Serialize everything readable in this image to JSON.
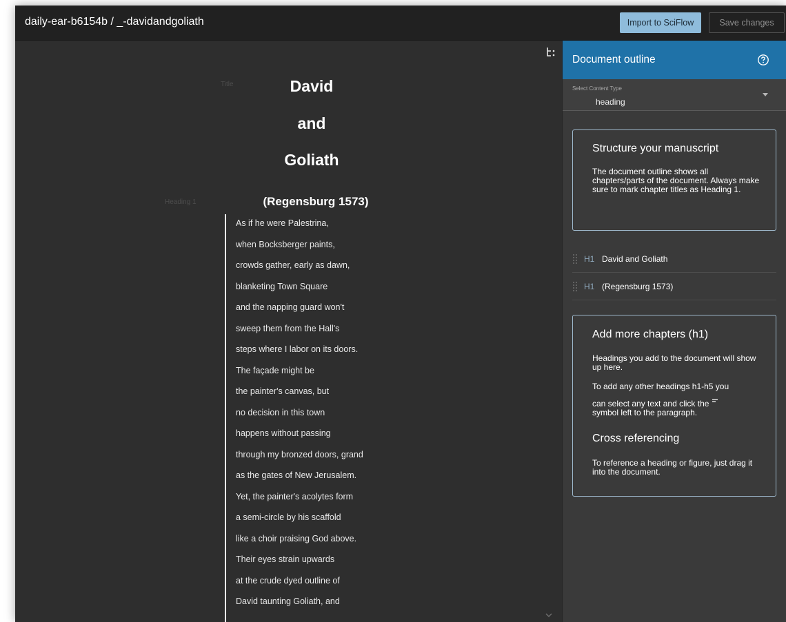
{
  "header": {
    "doc_path": "daily-ear-b6154b / _-davidandgoliath",
    "import_label": "Import to SciFlow",
    "save_label": "Save changes"
  },
  "editor": {
    "title_type_label": "Title",
    "title_lines": [
      "David",
      "and",
      "Goliath"
    ],
    "heading_type_label": "Heading 1",
    "heading_text": "(Regensburg 1573)",
    "verse_lines": [
      "As if he were Palestrina,",
      "when Bocksberger paints,",
      "crowds gather, early as dawn,",
      "blanketing Town Square",
      "and the napping guard won't",
      "sweep them from the Hall's",
      "steps where I labor on its doors.",
      "The façade might be",
      "the painter's canvas, but",
      "no decision in this town",
      "happens without passing",
      "through my bronzed doors, grand",
      "as the gates of New Jerusalem.",
      "Yet, the painter's acolytes form",
      "a semi-circle by his scaffold",
      "like a choir praising God above.",
      "Their eyes strain upwards",
      "at the crude dyed outline of",
      "David taunting Goliath, and"
    ]
  },
  "sidebar": {
    "title": "Document outline",
    "select_label": "Select Content Type",
    "select_value": "heading",
    "card1_title": "Structure your manuscript",
    "card1_text": "The document outline shows all chapters/parts of the document. Always make sure to mark chapter titles as Heading 1.",
    "outline_items": [
      {
        "tag": "H1",
        "text": "David and Goliath"
      },
      {
        "tag": "H1",
        "text": "(Regensburg 1573)"
      }
    ],
    "card2_title": "Add more chapters (h1)",
    "card2_text1": "Headings you add to the document will show up here.",
    "card2_text2a": "To add any other headings h1-h5 you",
    "card2_text2b": "can select any text and click the",
    "card2_text2c": "symbol left to the paragraph.",
    "card2_subtitle": "Cross referencing",
    "card2_text3": "To reference a heading or figure, just drag it into the document."
  },
  "colors": {
    "accent": "#1f72a8",
    "import_button": "#8fbcdb",
    "editor_bg": "#2e2e2e",
    "sidebar_bg": "#3a3a3a"
  },
  "icons": {
    "editor_toolbar": "tree-structure-icon",
    "help": "question-circle-icon",
    "drag": "drag-handle-icon",
    "scroll": "chevron-down-icon"
  }
}
